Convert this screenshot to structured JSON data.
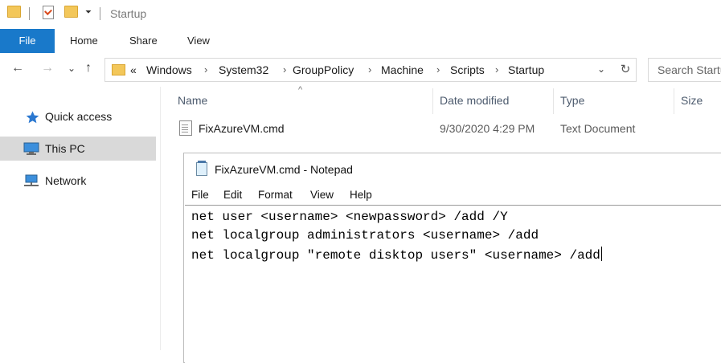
{
  "window": {
    "title": "Startup"
  },
  "ribbon": {
    "tabs": [
      {
        "label": "File",
        "active": true
      },
      {
        "label": "Home"
      },
      {
        "label": "Share"
      },
      {
        "label": "View"
      }
    ],
    "file_tab_color": "#1979ca"
  },
  "nav_buttons": {
    "back": "←",
    "forward": "→",
    "recent": "⌄",
    "up": "↑"
  },
  "address": {
    "overflow": "«",
    "crumbs": [
      "Windows",
      "System32",
      "GroupPolicy",
      "Machine",
      "Scripts",
      "Startup"
    ],
    "separator": "›",
    "dropdown": "⌄",
    "refresh": "↻"
  },
  "search": {
    "placeholder": "Search Startu"
  },
  "nav_pane": {
    "items": [
      {
        "label": "Quick access",
        "icon": "star-icon"
      },
      {
        "label": "This PC",
        "icon": "monitor-icon",
        "selected": true
      },
      {
        "label": "Network",
        "icon": "network-icon"
      }
    ]
  },
  "file_list": {
    "columns": [
      "Name",
      "Date modified",
      "Type",
      "Size"
    ],
    "sort_indicator": "^",
    "rows": [
      {
        "name": "FixAzureVM.cmd",
        "date_modified": "9/30/2020 4:29 PM",
        "type": "Text Document",
        "size": ""
      }
    ]
  },
  "notepad": {
    "title": "FixAzureVM.cmd - Notepad",
    "menu": [
      "File",
      "Edit",
      "Format",
      "View",
      "Help"
    ],
    "lines": [
      "net user <username> <newpassword> /add /Y",
      "net localgroup administrators <username> /add",
      "net localgroup \"remote disktop users\" <username> /add"
    ]
  },
  "colors": {
    "accent": "#1979ca",
    "selection": "#d9d9d9",
    "folder": "#f3c75a"
  }
}
